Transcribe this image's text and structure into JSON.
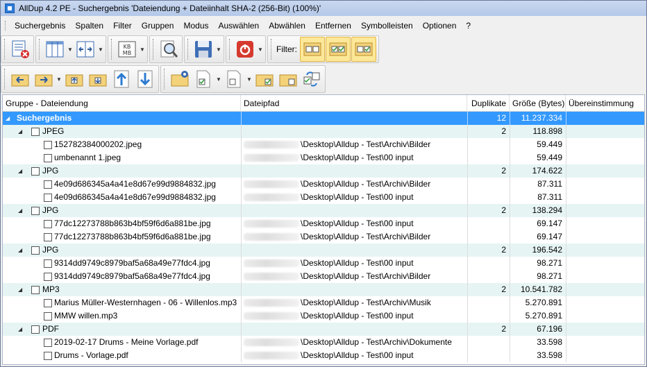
{
  "window": {
    "title": "AllDup 4.2 PE - Suchergebnis 'Dateiendung + Dateiinhalt SHA-2 (256-Bit) (100%)'"
  },
  "menu": [
    "Suchergebnis",
    "Spalten",
    "Filter",
    "Gruppen",
    "Modus",
    "Auswählen",
    "Abwählen",
    "Entfernen",
    "Symbolleisten",
    "Optionen",
    "?"
  ],
  "toolbar": {
    "filter_label": "Filter:"
  },
  "grid": {
    "columns": [
      "Gruppe - Dateiendung",
      "Dateipfad",
      "Duplikate",
      "Größe (Bytes)",
      "Übereinstimmung"
    ],
    "root": {
      "label": "Suchergebnis",
      "duplicates": "12",
      "size": "11.237.334"
    },
    "groups": [
      {
        "label": "JPEG",
        "duplicates": "2",
        "size": "118.898",
        "files": [
          {
            "name": "152782384000202.jpeg",
            "path": "\\Desktop\\Alldup - Test\\Archiv\\Bilder",
            "size": "59.449"
          },
          {
            "name": "umbenannt 1.jpeg",
            "path": "\\Desktop\\Alldup - Test\\00 input",
            "size": "59.449"
          }
        ]
      },
      {
        "label": "JPG",
        "duplicates": "2",
        "size": "174.622",
        "files": [
          {
            "name": "4e09d686345a4a41e8d67e99d9884832.jpg",
            "path": "\\Desktop\\Alldup - Test\\Archiv\\Bilder",
            "size": "87.311"
          },
          {
            "name": "4e09d686345a4a41e8d67e99d9884832.jpg",
            "path": "\\Desktop\\Alldup - Test\\00 input",
            "size": "87.311"
          }
        ]
      },
      {
        "label": "JPG",
        "duplicates": "2",
        "size": "138.294",
        "files": [
          {
            "name": "77dc12273788b863b4bf59f6d6a881be.jpg",
            "path": "\\Desktop\\Alldup - Test\\00 input",
            "size": "69.147"
          },
          {
            "name": "77dc12273788b863b4bf59f6d6a881be.jpg",
            "path": "\\Desktop\\Alldup - Test\\Archiv\\Bilder",
            "size": "69.147"
          }
        ]
      },
      {
        "label": "JPG",
        "duplicates": "2",
        "size": "196.542",
        "files": [
          {
            "name": "9314dd9749c8979baf5a68a49e77fdc4.jpg",
            "path": "\\Desktop\\Alldup - Test\\00 input",
            "size": "98.271"
          },
          {
            "name": "9314dd9749c8979baf5a68a49e77fdc4.jpg",
            "path": "\\Desktop\\Alldup - Test\\Archiv\\Bilder",
            "size": "98.271"
          }
        ]
      },
      {
        "label": "MP3",
        "duplicates": "2",
        "size": "10.541.782",
        "files": [
          {
            "name": "Marius Müller-Westernhagen - 06 - Willenlos.mp3",
            "path": "\\Desktop\\Alldup - Test\\Archiv\\Musik",
            "size": "5.270.891"
          },
          {
            "name": "MMW willen.mp3",
            "path": "\\Desktop\\Alldup - Test\\00 input",
            "size": "5.270.891"
          }
        ]
      },
      {
        "label": "PDF",
        "duplicates": "2",
        "size": "67.196",
        "files": [
          {
            "name": "2019-02-17 Drums - Meine Vorlage.pdf",
            "path": "\\Desktop\\Alldup - Test\\Archiv\\Dokumente",
            "size": "33.598"
          },
          {
            "name": "Drums - Vorlage.pdf",
            "path": "\\Desktop\\Alldup - Test\\00 input",
            "size": "33.598"
          }
        ]
      }
    ]
  },
  "colors": {
    "selection": "#3399ff",
    "alt_row": "#e6f4f4",
    "titlebar": "#b4c8e8"
  }
}
